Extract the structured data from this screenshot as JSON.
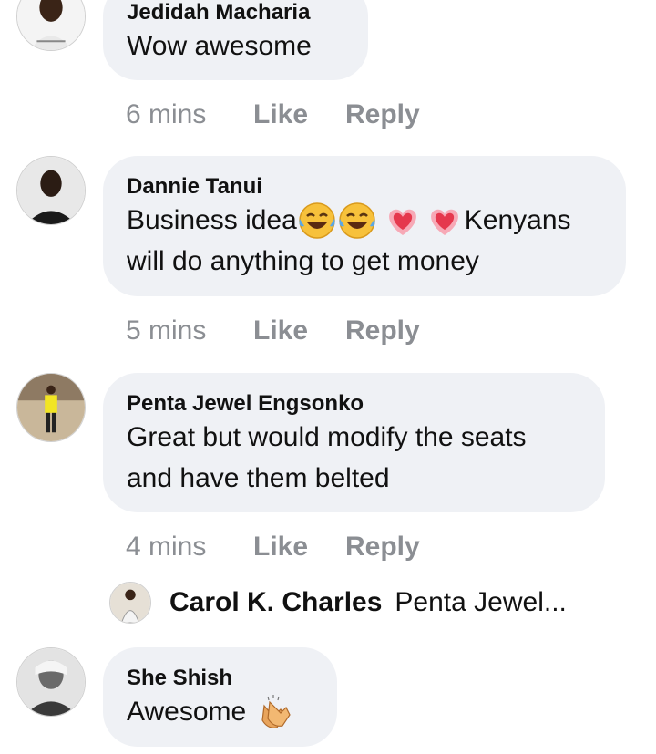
{
  "comments": [
    {
      "author": "Jedidah Macharia",
      "text": "Wow awesome",
      "time": "6 mins",
      "like": "Like",
      "reply": "Reply"
    },
    {
      "author": "Dannie Tanui",
      "text_before": "Business idea",
      "emojis": [
        "tears-of-joy-emoji",
        "tears-of-joy-emoji",
        "sparkling-heart-emoji",
        "sparkling-heart-emoji"
      ],
      "text_after": "Kenyans",
      "text_line2": "will do anything to get money",
      "time": "5 mins",
      "like": "Like",
      "reply": "Reply"
    },
    {
      "author": "Penta Jewel Engsonko",
      "text": "Great but would modify the seats\nand have them belted",
      "time": "4 mins",
      "like": "Like",
      "reply": "Reply"
    },
    {
      "author": "She Shish",
      "text": "Awesome",
      "emoji": "clapping-hands-emoji"
    }
  ],
  "reply_preview": {
    "author": "Carol K. Charles",
    "text": "Penta Jewel..."
  },
  "colors": {
    "bubble": "#eff1f5",
    "meta": "#8b8e93",
    "text": "#111111"
  }
}
